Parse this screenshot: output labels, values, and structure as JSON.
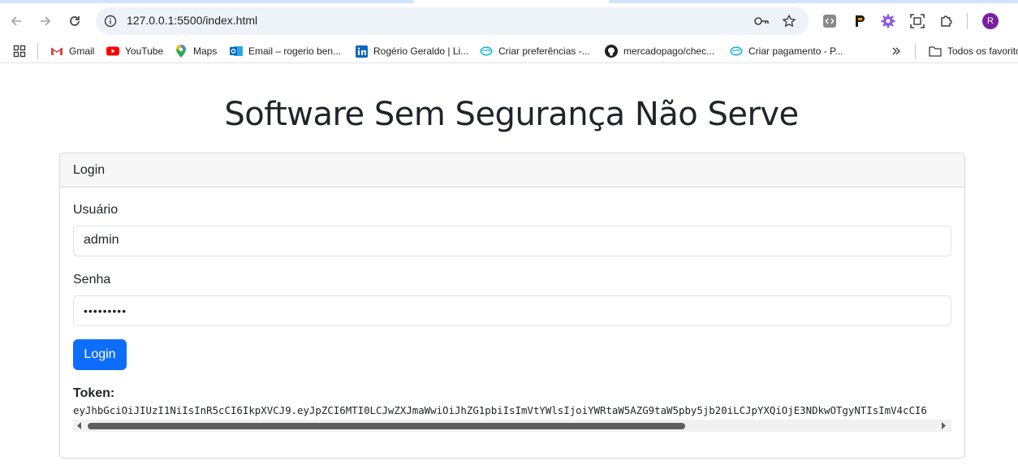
{
  "browser": {
    "url": "127.0.0.1:5500/index.html",
    "profile_initial": "R"
  },
  "bookmarks": [
    {
      "label": "Gmail",
      "icon": "gmail-icon"
    },
    {
      "label": "YouTube",
      "icon": "youtube-icon"
    },
    {
      "label": "Maps",
      "icon": "maps-icon"
    },
    {
      "label": "Email – rogerio ben...",
      "icon": "outlook-icon"
    },
    {
      "label": "Rogério Geraldo | Li...",
      "icon": "linkedin-icon"
    },
    {
      "label": "Criar preferências -...",
      "icon": "mercadopago-icon"
    },
    {
      "label": "mercadopago/chec...",
      "icon": "github-icon"
    },
    {
      "label": "Criar pagamento - P...",
      "icon": "mercadopago-icon"
    }
  ],
  "bookmarks_folder": "Todos os favoritos",
  "page": {
    "title": "Software Sem Segurança Não Serve",
    "card_header": "Login",
    "username_label": "Usuário",
    "username_value": "admin",
    "password_label": "Senha",
    "password_value": "•••••••••",
    "login_button": "Login",
    "token_label": "Token:",
    "token_value": "eyJhbGciOiJIUzI1NiIsInR5cCI6IkpXVCJ9.eyJpZCI6MTI0LCJwZXJmaWwiOiJhZG1pbiIsImVtYWlsIjoiYWRtaW5AZG9taW5pby5jb20iLCJpYXQiOjE3NDkwOTgyNTIsImV4cCI6"
  },
  "colors": {
    "primary": "#0d6efd",
    "omnibox_bg": "#eef2f9",
    "avatar": "#7b1fa2"
  }
}
